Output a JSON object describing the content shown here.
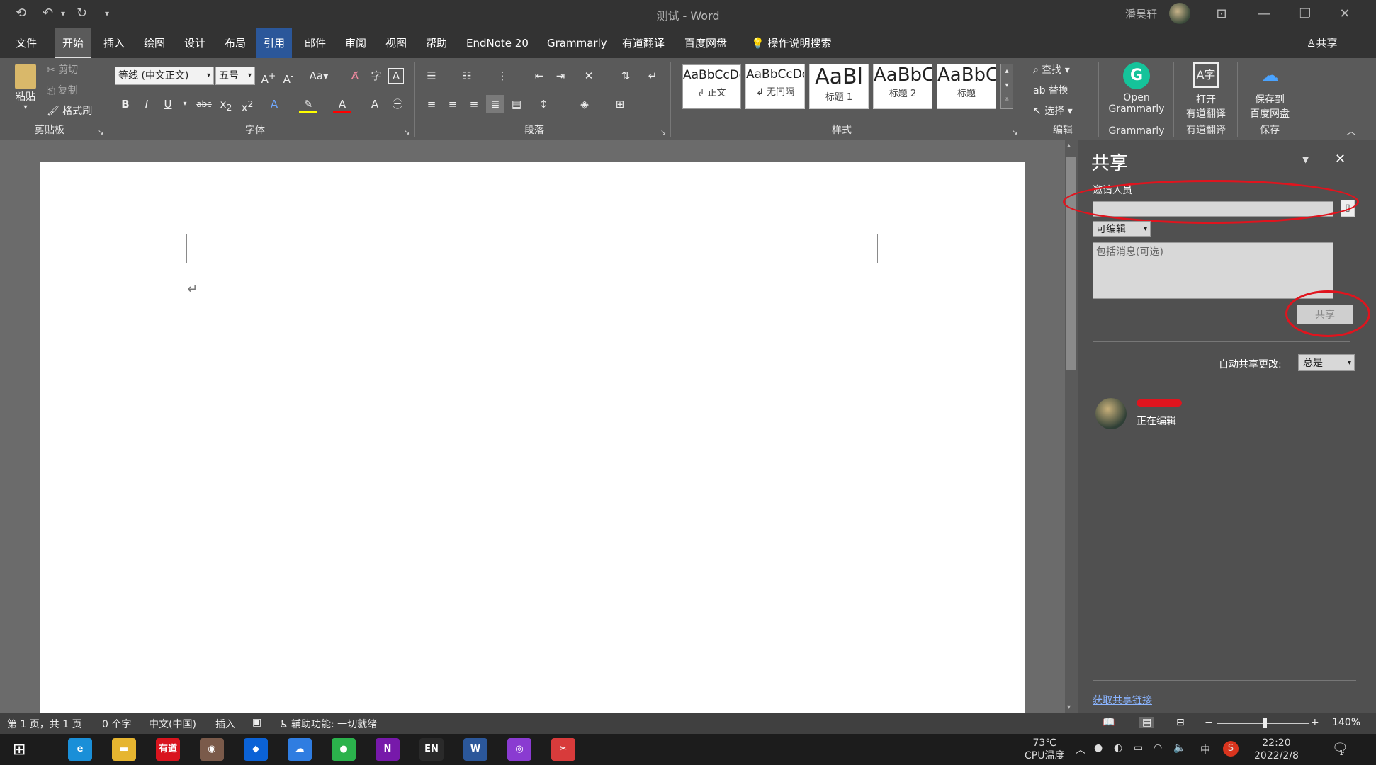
{
  "window": {
    "title": "测试 - Word",
    "user_name": "潘昊轩"
  },
  "tabs": [
    "文件",
    "开始",
    "插入",
    "绘图",
    "设计",
    "布局",
    "引用",
    "邮件",
    "审阅",
    "视图",
    "帮助",
    "EndNote 20",
    "Grammarly",
    "有道翻译",
    "百度网盘"
  ],
  "tell_me": "操作说明搜索",
  "share_button": "共享",
  "clipboard": {
    "paste": "粘贴",
    "cut": "剪切",
    "copy": "复制",
    "format_painter": "格式刷",
    "group": "剪贴板"
  },
  "font": {
    "name": "等线 (中文正文)",
    "size": "五号",
    "group": "字体",
    "case": "Aa"
  },
  "paragraph": {
    "group": "段落"
  },
  "styles": {
    "group": "样式",
    "items": [
      {
        "preview": "AaBbCcDc",
        "label": "↲ 正文"
      },
      {
        "preview": "AaBbCcDc",
        "label": "↲ 无间隔"
      },
      {
        "preview": "AaBl",
        "label": "标题 1"
      },
      {
        "preview": "AaBbC",
        "label": "标题 2"
      },
      {
        "preview": "AaBbC",
        "label": "标题"
      }
    ]
  },
  "editing": {
    "find": "查找",
    "replace": "替换",
    "select": "选择",
    "group": "编辑"
  },
  "grammarly": {
    "line1": "Open",
    "line2": "Grammarly",
    "group": "Grammarly"
  },
  "youdao": {
    "line1": "打开",
    "line2": "有道翻译",
    "group": "有道翻译"
  },
  "baidu": {
    "line1": "保存到",
    "line2": "百度网盘",
    "group": "保存"
  },
  "share_pane": {
    "title": "共享",
    "invite_label": "邀请人员",
    "invite_value": "",
    "permission": "可编辑",
    "message_placeholder": "包括消息(可选)",
    "share_button": "共享",
    "auto_share_label": "自动共享更改:",
    "auto_share_value": "总是",
    "collaborator_status": "正在编辑",
    "get_link": "获取共享链接"
  },
  "statusbar": {
    "page": "第 1 页，共 1 页",
    "words": "0 个字",
    "language": "中文(中国)",
    "mode": "插入",
    "accessibility": "辅助功能: 一切就绪",
    "zoom": "140%",
    "zoom_minus": "−",
    "zoom_plus": "+"
  },
  "taskbar": {
    "apps": [
      {
        "icon": "edge-icon",
        "label": "e",
        "color": "#1a8fd8"
      },
      {
        "icon": "file-explorer-icon",
        "label": "▬",
        "color": "#e6b530"
      },
      {
        "icon": "youdao-icon",
        "label": "有道",
        "color": "#d9141e"
      },
      {
        "icon": "avatar-app-icon",
        "label": "◉",
        "color": "#7a5a4a"
      },
      {
        "icon": "dropbox-icon",
        "label": "◆",
        "color": "#0b62d6"
      },
      {
        "icon": "baidu-netdisk-icon",
        "label": "☁",
        "color": "#2f7de1"
      },
      {
        "icon": "wechat-icon",
        "label": "●",
        "color": "#2bb24c"
      },
      {
        "icon": "onenote-icon",
        "label": "N",
        "color": "#7719aa"
      },
      {
        "icon": "endnote-icon",
        "label": "EN",
        "color": "#2a2a2a"
      },
      {
        "icon": "word-icon",
        "label": "W",
        "color": "#2b579a"
      },
      {
        "icon": "zotero-like-icon",
        "label": "◎",
        "color": "#8a3bd1"
      },
      {
        "icon": "snipping-icon",
        "label": "✂",
        "color": "#d83b3b"
      }
    ],
    "temp": "73℃",
    "temp_label": "CPU温度",
    "ime": "中",
    "time": "22:20",
    "date": "2022/2/8",
    "notif_count": "1"
  }
}
